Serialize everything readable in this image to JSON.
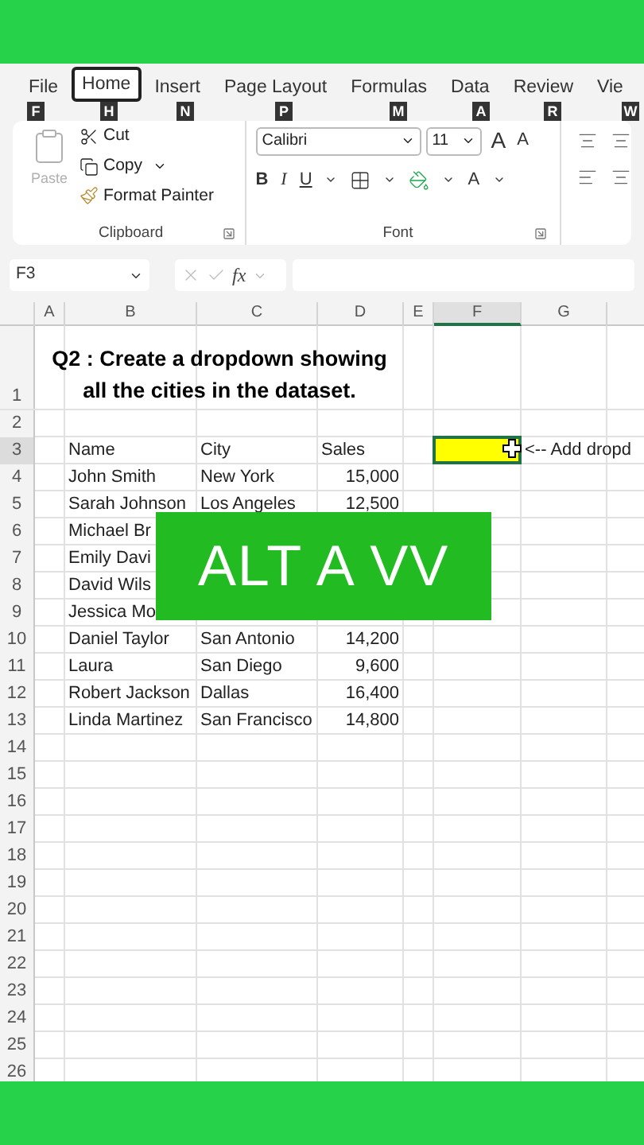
{
  "ribbon": {
    "tabs": [
      {
        "label": "File",
        "keytip": "F",
        "selected": false
      },
      {
        "label": "Home",
        "keytip": "H",
        "selected": true
      },
      {
        "label": "Insert",
        "keytip": "N",
        "selected": false
      },
      {
        "label": "Page Layout",
        "keytip": "P",
        "selected": false
      },
      {
        "label": "Formulas",
        "keytip": "M",
        "selected": false
      },
      {
        "label": "Data",
        "keytip": "A",
        "selected": false
      },
      {
        "label": "Review",
        "keytip": "R",
        "selected": false
      },
      {
        "label": "Vie",
        "keytip": "W",
        "selected": false
      }
    ],
    "clipboard": {
      "paste": "Paste",
      "paste_disabled": true,
      "cut": "Cut",
      "copy": "Copy",
      "format_painter": "Format Painter",
      "label": "Clipboard"
    },
    "font": {
      "name": "Calibri",
      "size": "11",
      "grow": "A",
      "shrink": "A",
      "bold": "B",
      "italic": "I",
      "underline": "U",
      "font_color": "A",
      "label": "Font"
    }
  },
  "formula_bar": {
    "name_box": "F3",
    "fx": "fx"
  },
  "sheet": {
    "columns": [
      {
        "label": "A",
        "selected": false
      },
      {
        "label": "B",
        "selected": false
      },
      {
        "label": "C",
        "selected": false
      },
      {
        "label": "D",
        "selected": false
      },
      {
        "label": "E",
        "selected": false
      },
      {
        "label": "F",
        "selected": true
      },
      {
        "label": "G",
        "selected": false
      }
    ],
    "rows": [
      {
        "header": "1",
        "selected": false,
        "kind": "title",
        "lines": [
          "Q2 : Create a dropdown showing",
          "all the cities in the dataset."
        ]
      },
      {
        "header": "2",
        "selected": false,
        "kind": "empty"
      },
      {
        "header": "3",
        "selected": true,
        "kind": "header",
        "cells": [
          "",
          "Name",
          "City",
          "Sales",
          "",
          "",
          "<-- Add dropd"
        ]
      },
      {
        "header": "4",
        "selected": false,
        "kind": "data",
        "cells": [
          "",
          "John Smith",
          "New York",
          "15,000"
        ]
      },
      {
        "header": "5",
        "selected": false,
        "kind": "data",
        "cells": [
          "",
          "Sarah Johnson",
          "Los Angeles",
          "12,500"
        ]
      },
      {
        "header": "6",
        "selected": false,
        "kind": "data",
        "cells": [
          "",
          "Michael Br"
        ]
      },
      {
        "header": "7",
        "selected": false,
        "kind": "data",
        "cells": [
          "",
          "Emily Davi"
        ]
      },
      {
        "header": "8",
        "selected": false,
        "kind": "data",
        "cells": [
          "",
          "David Wils"
        ]
      },
      {
        "header": "9",
        "selected": false,
        "kind": "data",
        "cells": [
          "",
          "Jessica Mo"
        ]
      },
      {
        "header": "10",
        "selected": false,
        "kind": "data",
        "cells": [
          "",
          "Daniel Taylor",
          "San Antonio",
          "14,200"
        ]
      },
      {
        "header": "11",
        "selected": false,
        "kind": "data",
        "cells": [
          "",
          "Laura",
          "San Diego",
          "9,600"
        ]
      },
      {
        "header": "12",
        "selected": false,
        "kind": "data",
        "cells": [
          "",
          "Robert Jackson",
          "Dallas",
          "16,400"
        ]
      },
      {
        "header": "13",
        "selected": false,
        "kind": "data",
        "cells": [
          "",
          "Linda Martinez",
          "San Francisco",
          "14,800"
        ]
      },
      {
        "header": "14",
        "selected": false,
        "kind": "empty"
      },
      {
        "header": "15",
        "selected": false,
        "kind": "empty"
      },
      {
        "header": "16",
        "selected": false,
        "kind": "empty"
      },
      {
        "header": "17",
        "selected": false,
        "kind": "empty"
      },
      {
        "header": "18",
        "selected": false,
        "kind": "empty"
      },
      {
        "header": "19",
        "selected": false,
        "kind": "empty"
      },
      {
        "header": "20",
        "selected": false,
        "kind": "empty"
      },
      {
        "header": "21",
        "selected": false,
        "kind": "empty"
      },
      {
        "header": "22",
        "selected": false,
        "kind": "empty"
      },
      {
        "header": "23",
        "selected": false,
        "kind": "empty"
      },
      {
        "header": "24",
        "selected": false,
        "kind": "empty"
      },
      {
        "header": "25",
        "selected": false,
        "kind": "empty"
      },
      {
        "header": "26",
        "selected": false,
        "kind": "empty"
      }
    ]
  },
  "overlay": {
    "text": "ALT A VV"
  }
}
